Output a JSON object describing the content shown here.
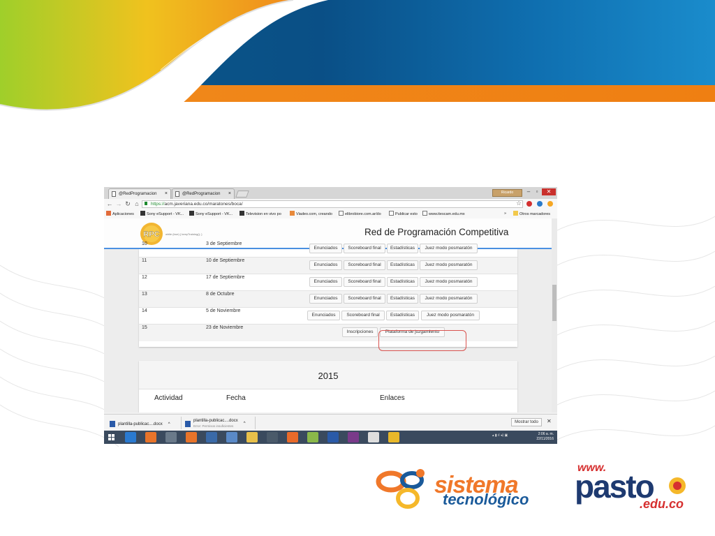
{
  "browser": {
    "tabs": [
      {
        "label": "@RedProgramacion"
      },
      {
        "label": "@RedProgramacion"
      }
    ],
    "user_badge": "Ricardo",
    "url_scheme": "https://",
    "url_rest": "acm.javeriana.edu.co/maratones/boca/",
    "bookmarks": [
      "Aplicaciones",
      "Sony eSupport - VK...",
      "Sony eSupport - VK...",
      "Television en vivo po",
      "Viadeo.com, creando",
      "elibrobiore.com.ar/do",
      "Publicar esto",
      "www.itescam.edu.mx",
      "»",
      "Otros marcadores"
    ]
  },
  "site": {
    "title": "Red de Programación Competitiva",
    "logo_text": "RPC",
    "logo_code": "while (true) { keepTraining(); }"
  },
  "table": {
    "rows": [
      {
        "num": "10",
        "date": "3 de Septiembre",
        "links": [
          "Enunciados",
          "Scoreboard final",
          "Estadísticas",
          "Juez modo posmaratón"
        ]
      },
      {
        "num": "11",
        "date": "10 de Septiembre",
        "links": [
          "Enunciados",
          "Scoreboard final",
          "Estadísticas",
          "Juez modo posmaratón"
        ]
      },
      {
        "num": "12",
        "date": "17 de Septiembre",
        "links": [
          "Enunciados",
          "Scoreboard final",
          "Estadísticas",
          "Juez modo posmaratón"
        ]
      },
      {
        "num": "13",
        "date": "8 de Octubre",
        "links": [
          "Enunciados",
          "Scoreboard final",
          "Estadísticas",
          "Juez modo posmaratón"
        ]
      },
      {
        "num": "14",
        "date": "5 de Noviembre",
        "links": [
          "Enunciados",
          "Scoreboard final",
          "Estadísticas",
          "Juez modo posmaratón"
        ]
      },
      {
        "num": "15",
        "date": "23 de Noviembre",
        "links": [
          "Inscripciones",
          "Plataforma de juzgamiento"
        ]
      }
    ]
  },
  "section2015": {
    "year": "2015",
    "headers": [
      "Actividad",
      "Fecha",
      "Enlaces"
    ]
  },
  "downloads": {
    "items": [
      {
        "name": "plantilla-publicac....docx",
        "sub": ""
      },
      {
        "name": "plantilla-publicac....docx",
        "sub": "Error: Permisos insuficientes"
      }
    ],
    "show_all": "Mostrar todo"
  },
  "taskbar": {
    "time": "2:06 a. m.",
    "date": "22/11/2016"
  },
  "logos": {
    "sistema_word": "sistema",
    "sistema_sub": "tecnológico",
    "pasto_www": "www.",
    "pasto_word": "pasto",
    "pasto_domain": ".edu.co"
  },
  "colors": {
    "header_blue": "#0a4f86",
    "header_orange": "#ef7f12",
    "accent_blue": "#4a90e2",
    "highlight_red": "#d9534f"
  }
}
